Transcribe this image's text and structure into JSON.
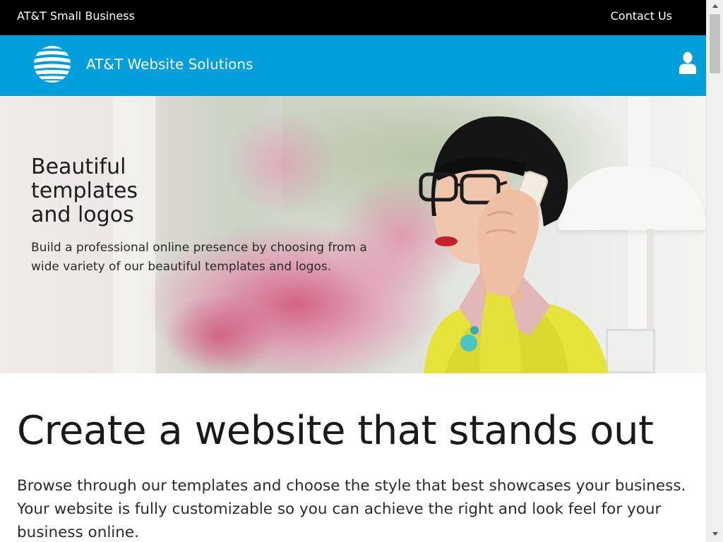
{
  "topbar": {
    "brand": "AT&T Small Business",
    "contact_link": "Contact Us"
  },
  "header": {
    "title": "AT&T Website Solutions",
    "logo_icon": "att-globe-icon",
    "account_icon": "user-icon",
    "background_color": "#009fdb"
  },
  "hero": {
    "heading_lines": [
      "Beautiful",
      "templates",
      "and logos"
    ],
    "description": "Build a professional online presence by choosing from a wide variety of our beautiful templates and logos."
  },
  "main": {
    "heading": "Create a website that stands out",
    "body": "Browse through our templates and choose the style that best showcases your business. Your website is fully customizable so you can achieve the right and look feel for your business online."
  },
  "colors": {
    "topbar": "#000000",
    "accent": "#009fdb",
    "text": "#1a1a1a"
  }
}
